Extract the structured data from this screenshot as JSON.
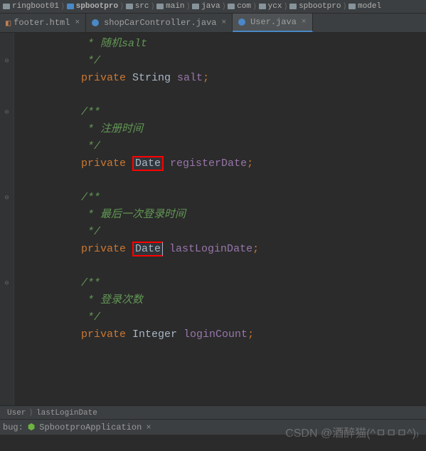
{
  "breadcrumbs": {
    "items": [
      {
        "label": "ringboot01"
      },
      {
        "label": "spbootpro"
      },
      {
        "label": "src"
      },
      {
        "label": "main"
      },
      {
        "label": "java"
      },
      {
        "label": "com"
      },
      {
        "label": "ycx"
      },
      {
        "label": "spbootpro"
      },
      {
        "label": "model"
      }
    ]
  },
  "tabs": {
    "items": [
      {
        "label": "footer.html",
        "active": false,
        "type": "html"
      },
      {
        "label": "shopCarController.java",
        "active": false,
        "type": "java"
      },
      {
        "label": "User.java",
        "active": true,
        "type": "java"
      }
    ]
  },
  "code": {
    "lines": [
      {
        "indent": "     ",
        "spans": [
          {
            "t": "* 随机salt",
            "cls": "comment"
          }
        ]
      },
      {
        "indent": "     ",
        "spans": [
          {
            "t": "*/",
            "cls": "comment"
          }
        ]
      },
      {
        "indent": "    ",
        "spans": [
          {
            "t": "private ",
            "cls": "keyword"
          },
          {
            "t": "String ",
            "cls": "type"
          },
          {
            "t": "salt",
            "cls": "ident"
          },
          {
            "t": ";",
            "cls": "semi"
          }
        ]
      },
      {
        "indent": "",
        "spans": []
      },
      {
        "indent": "    ",
        "spans": [
          {
            "t": "/**",
            "cls": "comment"
          }
        ]
      },
      {
        "indent": "     ",
        "spans": [
          {
            "t": "* 注册时间",
            "cls": "comment"
          }
        ]
      },
      {
        "indent": "     ",
        "spans": [
          {
            "t": "*/",
            "cls": "comment"
          }
        ]
      },
      {
        "indent": "    ",
        "spans": [
          {
            "t": "private ",
            "cls": "keyword"
          },
          {
            "t": "Date",
            "cls": "type",
            "red": true
          },
          {
            "t": " registerDate",
            "cls": "ident"
          },
          {
            "t": ";",
            "cls": "semi"
          }
        ]
      },
      {
        "indent": "",
        "spans": []
      },
      {
        "indent": "    ",
        "spans": [
          {
            "t": "/**",
            "cls": "comment"
          }
        ]
      },
      {
        "indent": "     ",
        "spans": [
          {
            "t": "* 最后一次登录时间",
            "cls": "comment"
          }
        ]
      },
      {
        "indent": "     ",
        "spans": [
          {
            "t": "*/",
            "cls": "comment"
          }
        ]
      },
      {
        "indent": "    ",
        "spans": [
          {
            "t": "private ",
            "cls": "keyword"
          },
          {
            "t": "Date",
            "cls": "type",
            "red": true,
            "caret": true
          },
          {
            "t": " lastLoginDate",
            "cls": "ident"
          },
          {
            "t": ";",
            "cls": "semi"
          }
        ]
      },
      {
        "indent": "",
        "spans": []
      },
      {
        "indent": "    ",
        "spans": [
          {
            "t": "/**",
            "cls": "comment"
          }
        ]
      },
      {
        "indent": "     ",
        "spans": [
          {
            "t": "* 登录次数",
            "cls": "comment"
          }
        ]
      },
      {
        "indent": "     ",
        "spans": [
          {
            "t": "*/",
            "cls": "comment"
          }
        ]
      },
      {
        "indent": "    ",
        "spans": [
          {
            "t": "private ",
            "cls": "keyword"
          },
          {
            "t": "Integer ",
            "cls": "type"
          },
          {
            "t": "loginCount",
            "cls": "ident"
          },
          {
            "t": ";",
            "cls": "semi"
          }
        ]
      },
      {
        "indent": "",
        "spans": []
      }
    ],
    "folds": [
      null,
      "⊖",
      null,
      null,
      "⊖",
      null,
      null,
      null,
      null,
      "⊖",
      null,
      null,
      null,
      null,
      "⊖",
      null,
      null,
      null,
      null
    ]
  },
  "bottomBreadcrumb": {
    "items": [
      {
        "label": "User"
      },
      {
        "label": "lastLoginDate"
      }
    ]
  },
  "debug": {
    "label": "bug:",
    "app": "SpbootproApplication",
    "close": "×"
  },
  "watermark": "CSDN @酒醉猫(^ㅁㅁㅁ^)₎"
}
